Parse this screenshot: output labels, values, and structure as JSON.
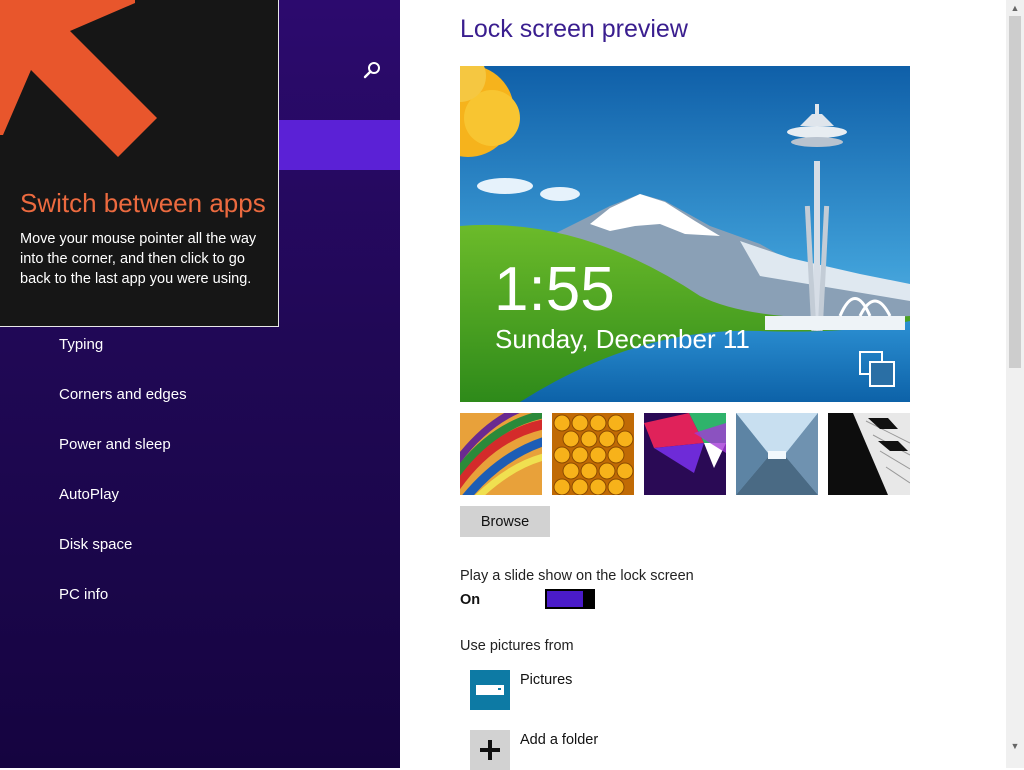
{
  "sidebar": {
    "items": [
      {
        "label": "Typing"
      },
      {
        "label": "Corners and edges"
      },
      {
        "label": "Power and sleep"
      },
      {
        "label": "AutoPlay"
      },
      {
        "label": "Disk space"
      },
      {
        "label": "PC info"
      }
    ]
  },
  "tip": {
    "title": "Switch between apps",
    "body": "Move your mouse pointer all the way into the corner, and then click to go back to the last app you were using."
  },
  "lock_screen": {
    "title": "Lock screen preview",
    "time": "1:55",
    "date": "Sunday, December 11",
    "browse_label": "Browse",
    "slideshow_label": "Play a slide show on the lock screen",
    "slideshow_state": "On",
    "use_pictures_label": "Use pictures from",
    "sources": [
      {
        "label": "Pictures",
        "icon": "pictures-folder-icon"
      },
      {
        "label": "Add a folder",
        "icon": "plus-icon"
      }
    ]
  },
  "colors": {
    "sidebar_bg": "#200855",
    "accent": "#5b21d6",
    "tip_title": "#ec6a3f",
    "title_text": "#3a1e8f",
    "toggle_on": "#4a1bc9",
    "pictures_tile": "#0d7aa4"
  }
}
